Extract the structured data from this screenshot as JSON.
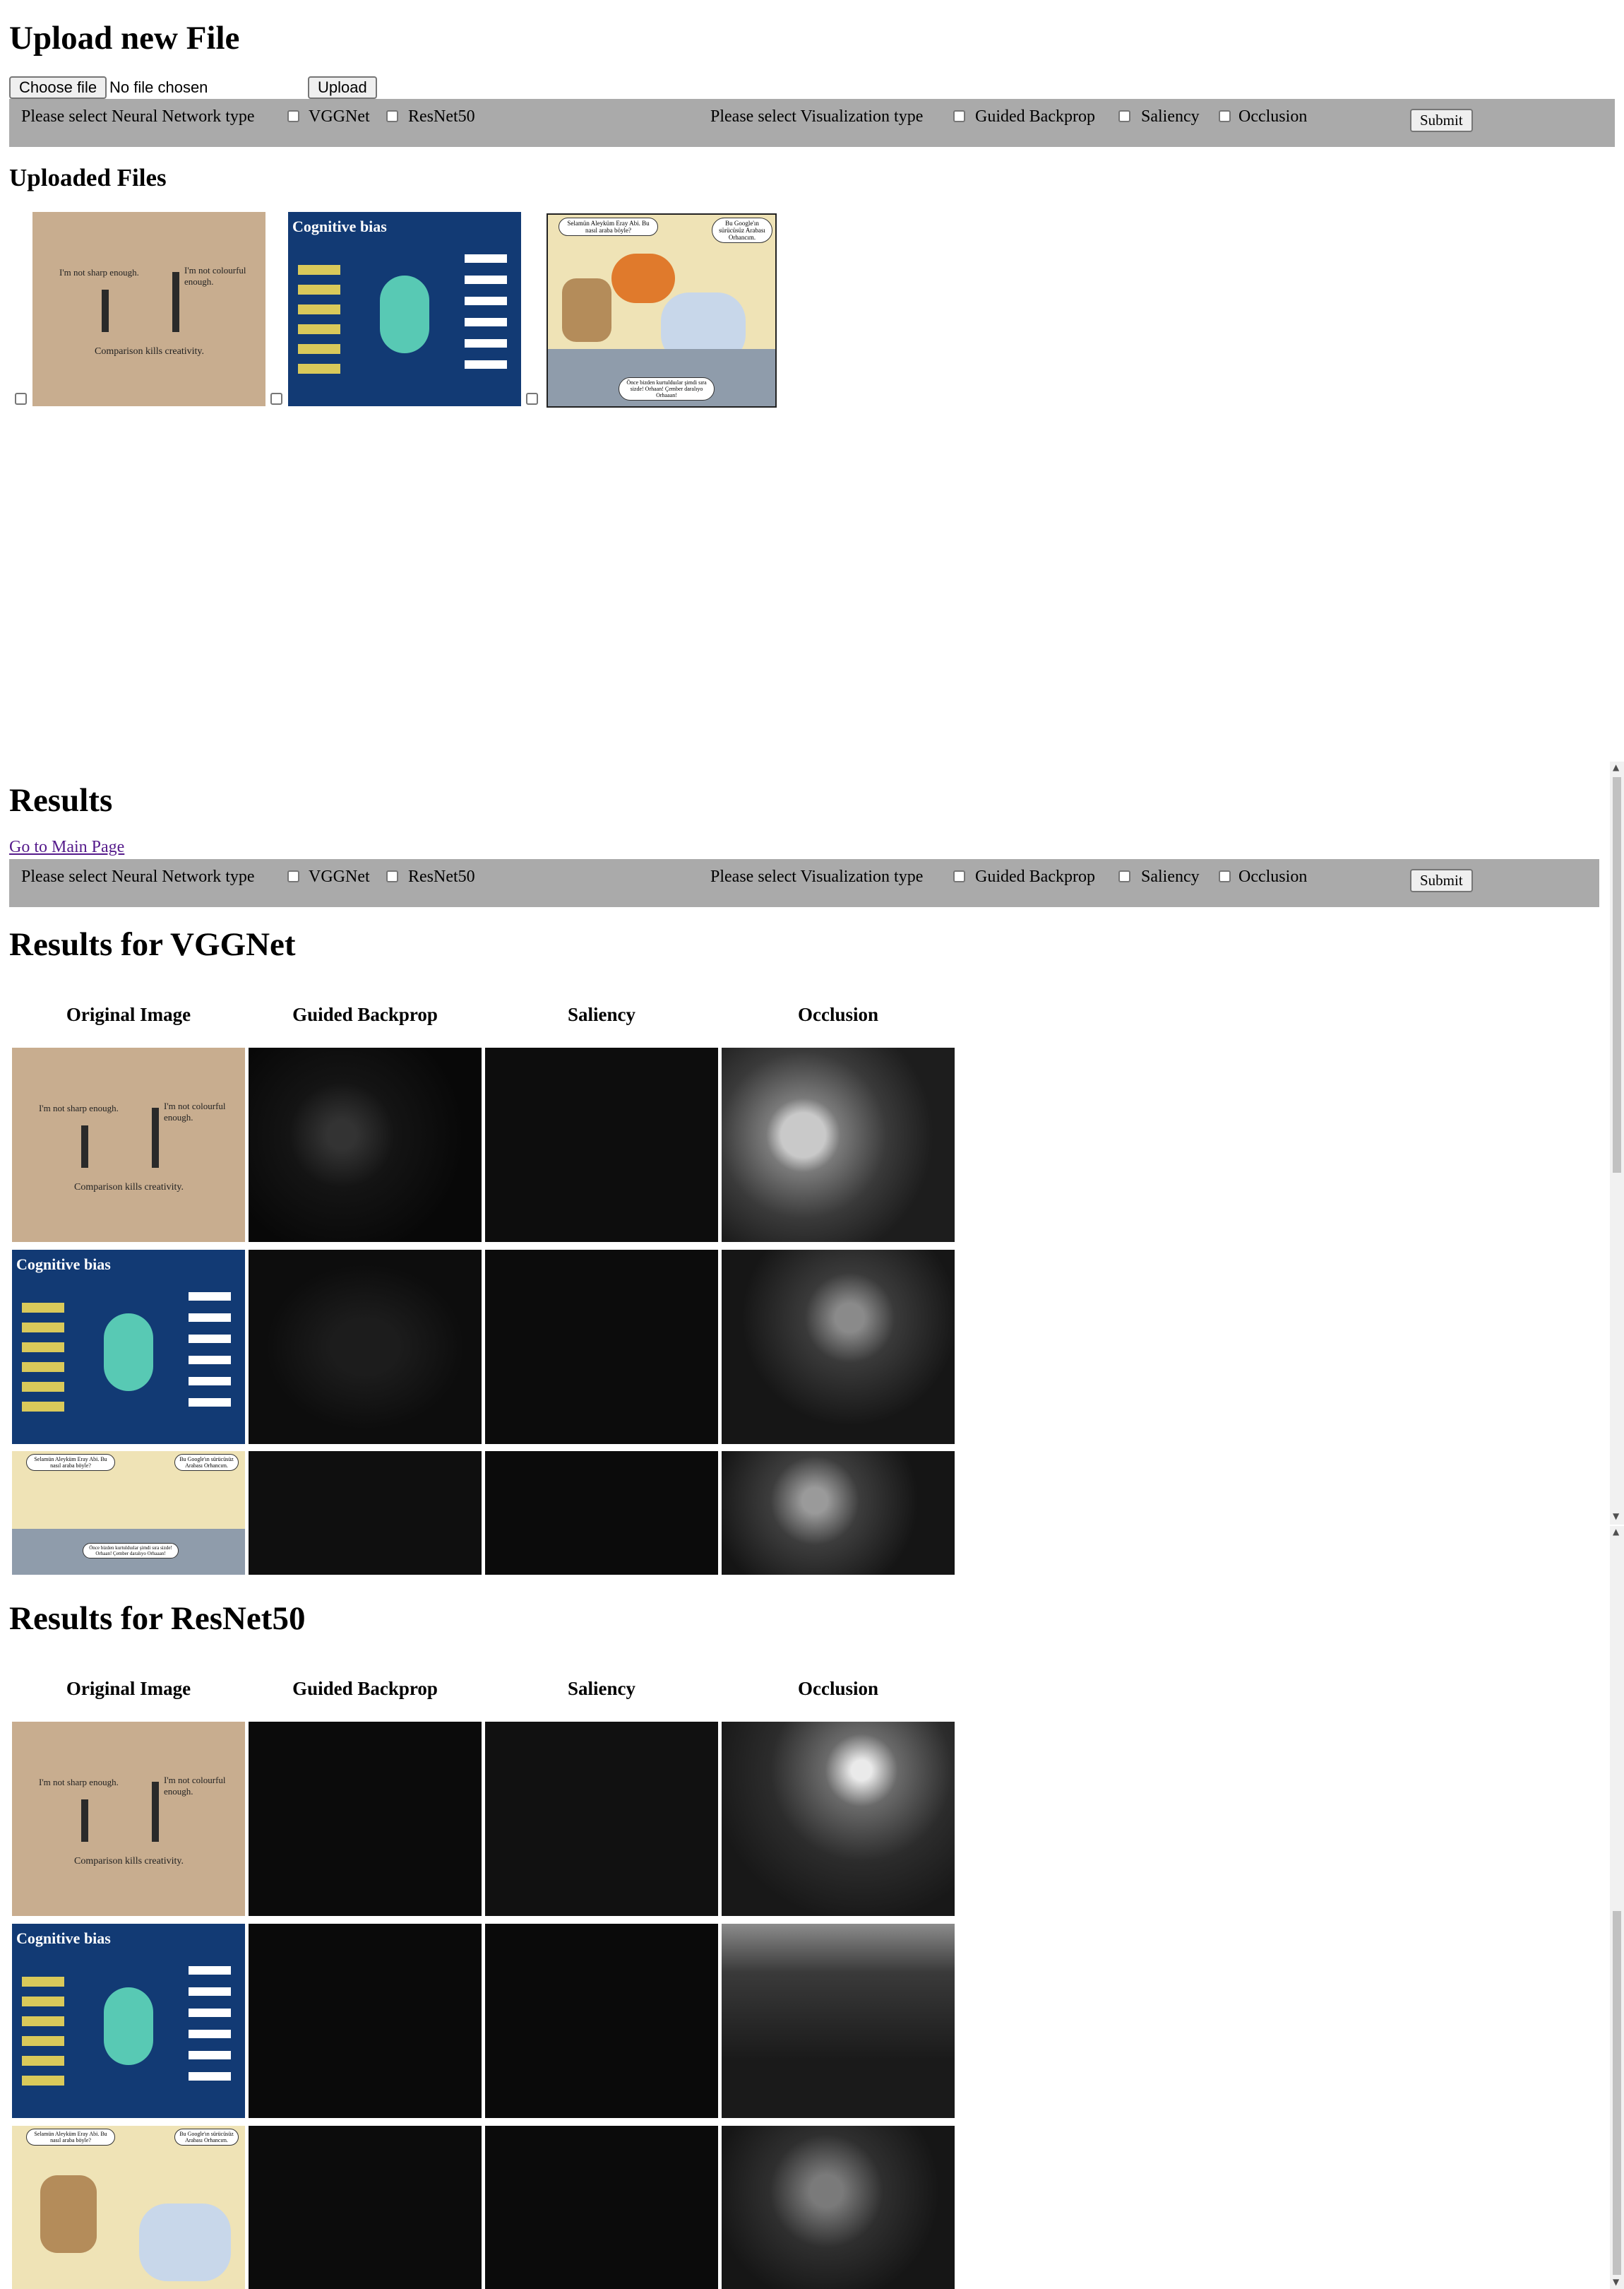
{
  "upload": {
    "title": "Upload new File",
    "choose_label": "Choose file",
    "no_file_text": "No file chosen",
    "upload_label": "Upload"
  },
  "form": {
    "nn_prompt": "Please select Neural Network type",
    "nn_options": [
      "VGGNet",
      "ResNet50"
    ],
    "viz_prompt": "Please select Visualization type",
    "viz_options": [
      "Guided Backprop",
      "Saliency",
      "Occlusion"
    ],
    "submit_label": "Submit"
  },
  "uploaded": {
    "title": "Uploaded Files",
    "images": [
      {
        "name": "pencils",
        "texts": [
          "I'm not sharp enough.",
          "I'm not colourful enough.",
          "Comparison kills creativity."
        ]
      },
      {
        "name": "cognitive-bias",
        "texts": [
          "Cognitive bias"
        ]
      },
      {
        "name": "comic",
        "texts": [
          "Selamün Aleyküm Eray Abi. Bu nasıl araba böyle?",
          "Bu Google'ın sürücüsüz Arabası Orhancım.",
          "Önce bizden kurtulduılar şimdi sıra sizde! Orhaan! Çember daralıyo Orhaaan!"
        ]
      }
    ]
  },
  "results": {
    "title": "Results",
    "main_link": "Go to Main Page",
    "sections": [
      {
        "title": "Results for VGGNet",
        "columns": [
          "Original Image",
          "Guided Backprop",
          "Saliency",
          "Occlusion"
        ]
      },
      {
        "title": "Results for ResNet50",
        "columns": [
          "Original Image",
          "Guided Backprop",
          "Saliency",
          "Occlusion"
        ]
      }
    ]
  }
}
